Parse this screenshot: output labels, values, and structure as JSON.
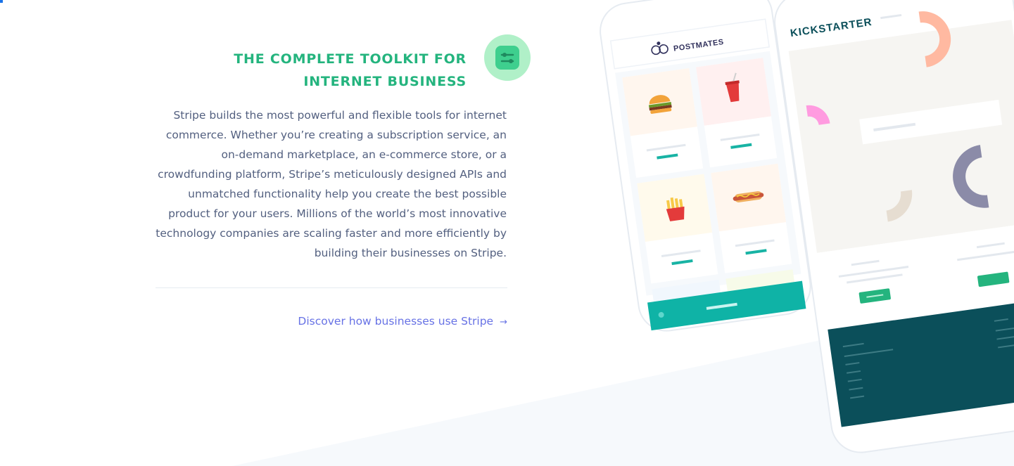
{
  "section": {
    "heading_line1": "THE COMPLETE TOOLKIT FOR",
    "heading_line2": "INTERNET BUSINESS",
    "icon": "toolkit-sliders-icon",
    "body": "Stripe builds the most powerful and flexible tools for internet commerce. Whether you’re creating a subscription service, an on-demand marketplace, an e-commerce store, or a crowdfunding platform, Stripe’s meticulously designed APIs and unmatched functionality help you create the best possible product for your users. Millions of the world’s most innovative technology companies are scaling faster and more efficiently by building their businesses on Stripe.",
    "link_label": "Discover how businesses use Stripe",
    "link_arrow": "→"
  },
  "devices": {
    "phone_brand": "POSTMATES",
    "phone_items": [
      "burger-icon",
      "soda-cup-icon",
      "fries-icon",
      "hotdog-icon"
    ],
    "tablet_brand": "KICKSTARTER"
  },
  "colors": {
    "accent_green": "#24b47e",
    "link_purple": "#6772e5",
    "teal": "#0fb3a6",
    "dark_teal": "#0b4f5a",
    "salmon": "#ffb9a1",
    "pink": "#ff9be0",
    "slate": "#8b8ba8",
    "beige": "#e6ddd1"
  }
}
